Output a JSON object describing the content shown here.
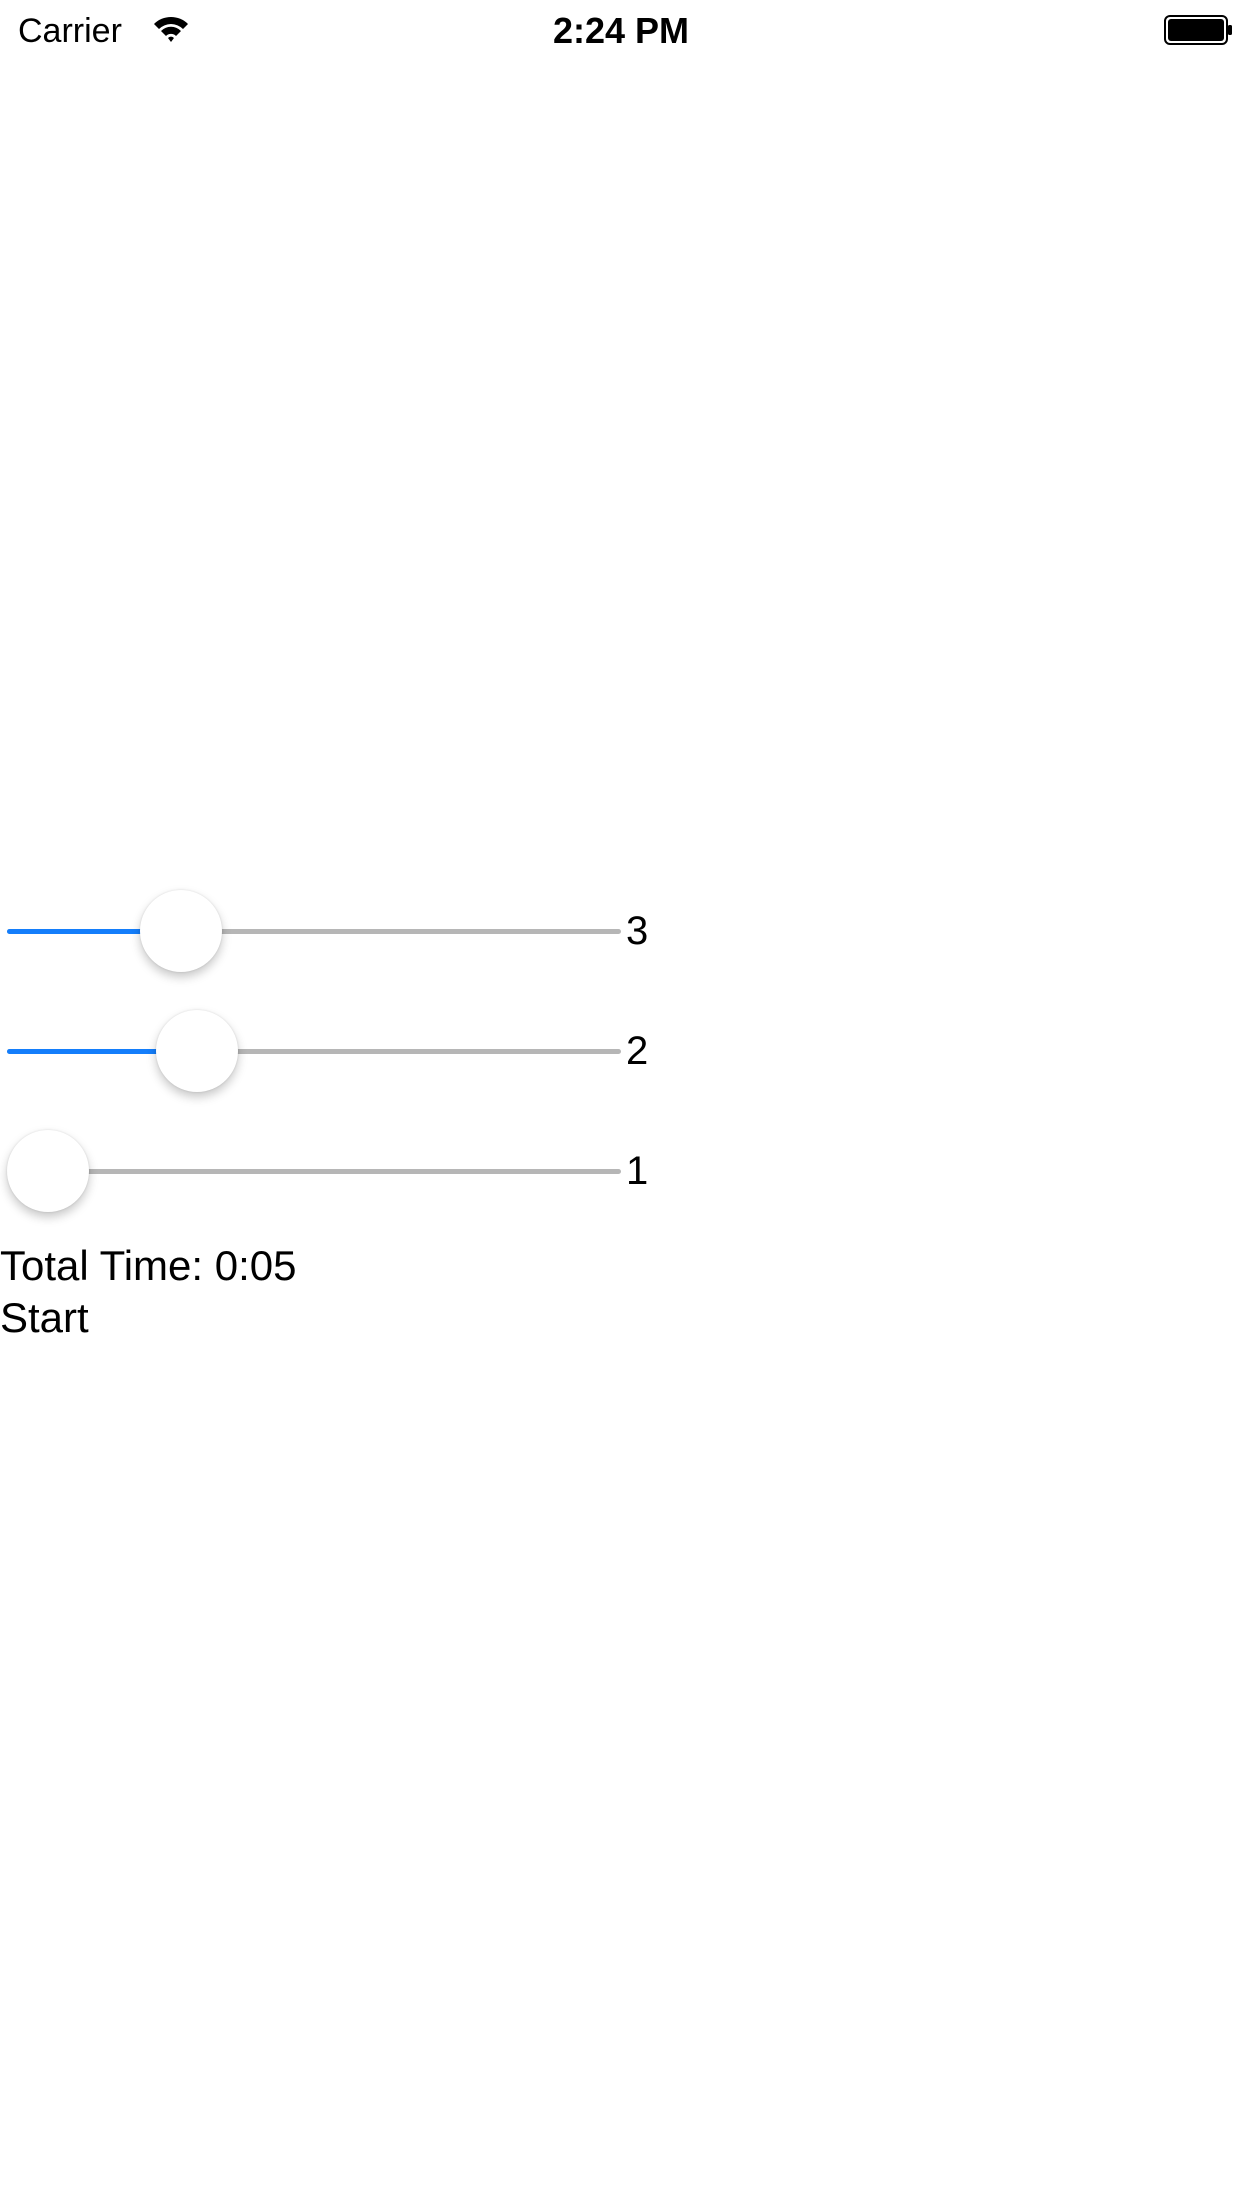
{
  "status_bar": {
    "carrier": "Carrier",
    "time": "2:24 PM",
    "wifi_icon": "wifi-icon",
    "battery_icon": "battery-icon"
  },
  "sliders": [
    {
      "value_label": "3",
      "fill_fraction": 0.25
    },
    {
      "value_label": "2",
      "fill_fraction": 0.28
    },
    {
      "value_label": "1",
      "fill_fraction": 0.0
    }
  ],
  "total_time_label": "Total Time: 0:05",
  "start_label": "Start",
  "colors": {
    "accent": "#147efb",
    "track": "#b6b6b6",
    "background": "#ffffff"
  }
}
